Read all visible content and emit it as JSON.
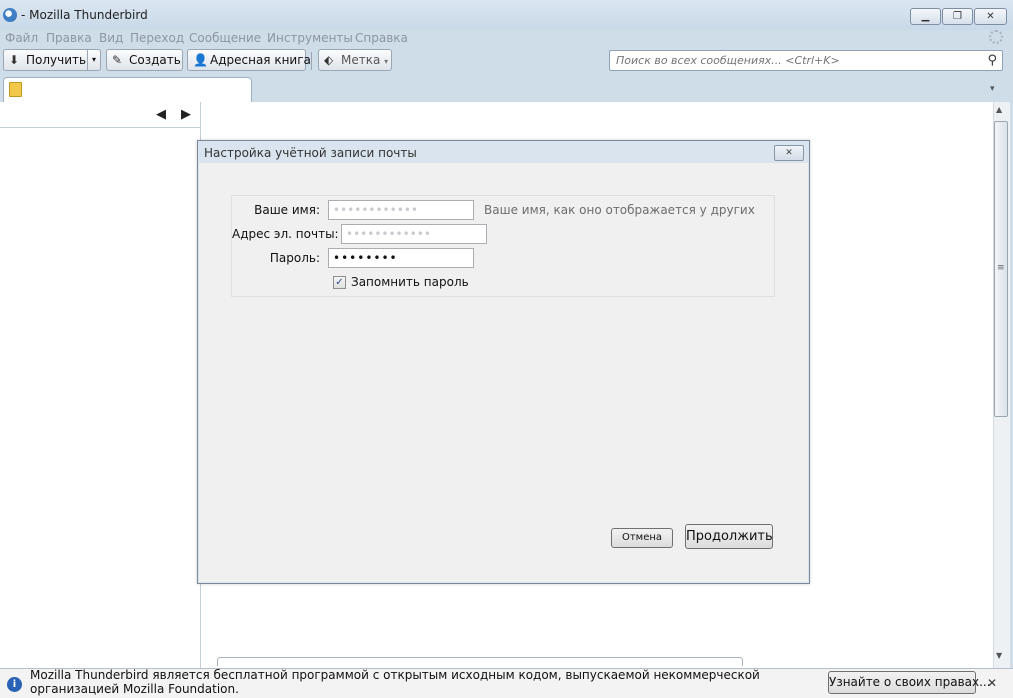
{
  "window": {
    "title": "- Mozilla Thunderbird",
    "controls": {
      "minimize": "▁",
      "maximize": "❐",
      "close": "✕"
    }
  },
  "menu": [
    "Файл",
    "Правка",
    "Вид",
    "Переход",
    "Сообщение",
    "Инструменты",
    "Справка"
  ],
  "toolbar": {
    "get_label": "Получить",
    "write_label": "Создать",
    "addressbook_label": "Адресная книга",
    "tag_label": "Метка",
    "search_placeholder": "Поиск во всех сообщениях... <Ctrl+K>"
  },
  "icons": {
    "get": "download-icon",
    "write": "pencil-icon",
    "addressbook": "person-icon",
    "tag": "tag-icon",
    "search": "magnifier-icon",
    "info": "info-icon"
  },
  "dialog": {
    "title": "Настройка учётной записи почты",
    "name_label": "Ваше имя:",
    "name_value": "••••••••••••",
    "name_hint": "Ваше имя, как оно отображается у других",
    "email_label": "Адрес эл. почты:",
    "email_value": "••••••••••••",
    "password_label": "Пароль:",
    "password_value": "••••••••",
    "remember_label": "Запомнить пароль",
    "remember_checked": true,
    "cancel_label": "Отмена",
    "continue_label": "Продолжить"
  },
  "notification": {
    "text": "Mozilla Thunderbird является бесплатной программой с открытым исходным кодом, выпускаемой некоммерческой организацией Mozilla Foundation.",
    "button_label": "Узнайте о своих правах..."
  },
  "colors": {
    "frame": "#cfdde9",
    "dialog_body": "#f0f0f0",
    "info_blue": "#2a63b5"
  }
}
